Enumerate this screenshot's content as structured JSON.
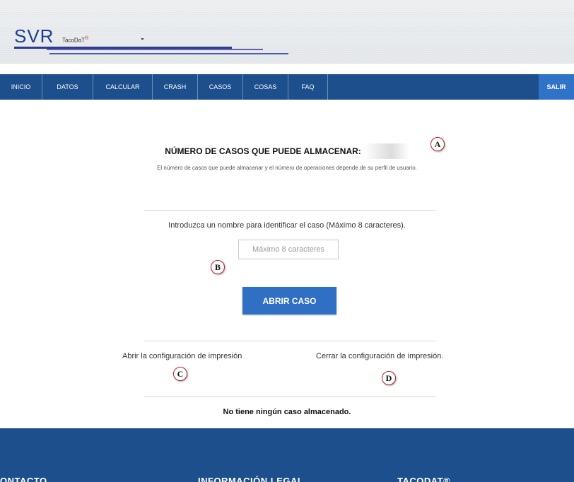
{
  "header": {
    "logo": "SVR",
    "logo_sub": "TacoDaT",
    "logo_mark": "®"
  },
  "nav": {
    "items": [
      "INICIO",
      "DATOS",
      "CALCULAR",
      "CRASH",
      "CASOS",
      "COSAS",
      "FAQ"
    ],
    "logout": "SALIR"
  },
  "main": {
    "title": "NÚMERO DE CASOS QUE PUEDE ALMACENAR:",
    "subtitle": "El número de casos que puede almacenar y el número de operaciones depende de su perfil de usuario.",
    "prompt": "Introduzca un nombre para identificar el caso (Máximo 8 caracteres).",
    "input": {
      "placeholder": "Máximo 8 caracteres",
      "value": ""
    },
    "open_button": "ABRIR CASO",
    "link_open_config": "Abrir la configuración de impresión",
    "link_close_config": "Cerrar la configuración de impresión.",
    "no_cases": "No tiene ningún caso almacenado."
  },
  "annotations": {
    "a": "A",
    "b": "B",
    "c": "C",
    "d": "D"
  },
  "footer": {
    "headings": [
      "ONTACTO",
      "INFORMACIÓN LEGAL",
      "TACODAT®"
    ]
  },
  "colors": {
    "nav_bg": "#1d4f8c",
    "accent": "#2f6fc4",
    "logo": "#1e3f8f",
    "badge_border": "#b22222"
  }
}
